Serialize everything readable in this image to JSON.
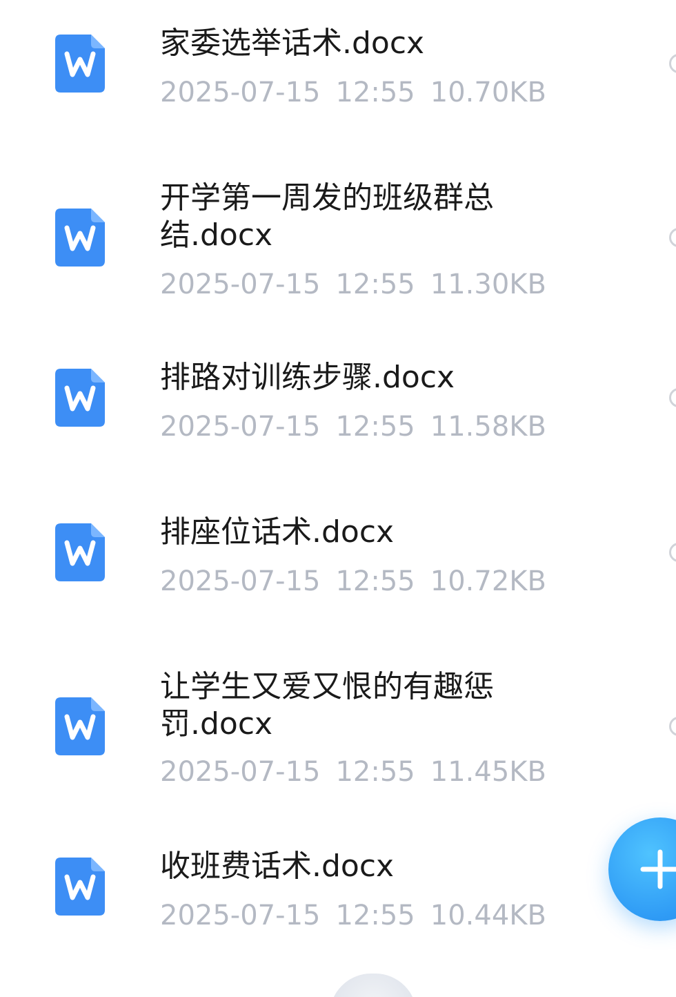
{
  "files": [
    {
      "name": "家委选举话术.docx",
      "date": "2025-07-15",
      "time": "12:55",
      "size": "10.70KB",
      "icon": "word-doc-icon"
    },
    {
      "name": "开学第一周发的班级群总结.docx",
      "date": "2025-07-15",
      "time": "12:55",
      "size": "11.30KB",
      "icon": "word-doc-icon"
    },
    {
      "name": "排路对训练步骤.docx",
      "date": "2025-07-15",
      "time": "12:55",
      "size": "11.58KB",
      "icon": "word-doc-icon"
    },
    {
      "name": "排座位话术.docx",
      "date": "2025-07-15",
      "time": "12:55",
      "size": "10.72KB",
      "icon": "word-doc-icon"
    },
    {
      "name": "让学生又爱又恨的有趣惩罚.docx",
      "date": "2025-07-15",
      "time": "12:55",
      "size": "11.45KB",
      "icon": "word-doc-icon"
    },
    {
      "name": "收班费话术.docx",
      "date": "2025-07-15",
      "time": "12:55",
      "size": "10.44KB",
      "icon": "word-doc-icon"
    }
  ],
  "fab": {
    "icon": "plus-icon"
  },
  "colors": {
    "accent": "#2f9bf5",
    "word_icon": "#3d8ef5",
    "name_text": "#1a1a1a",
    "meta_text": "#b4b9c3"
  }
}
